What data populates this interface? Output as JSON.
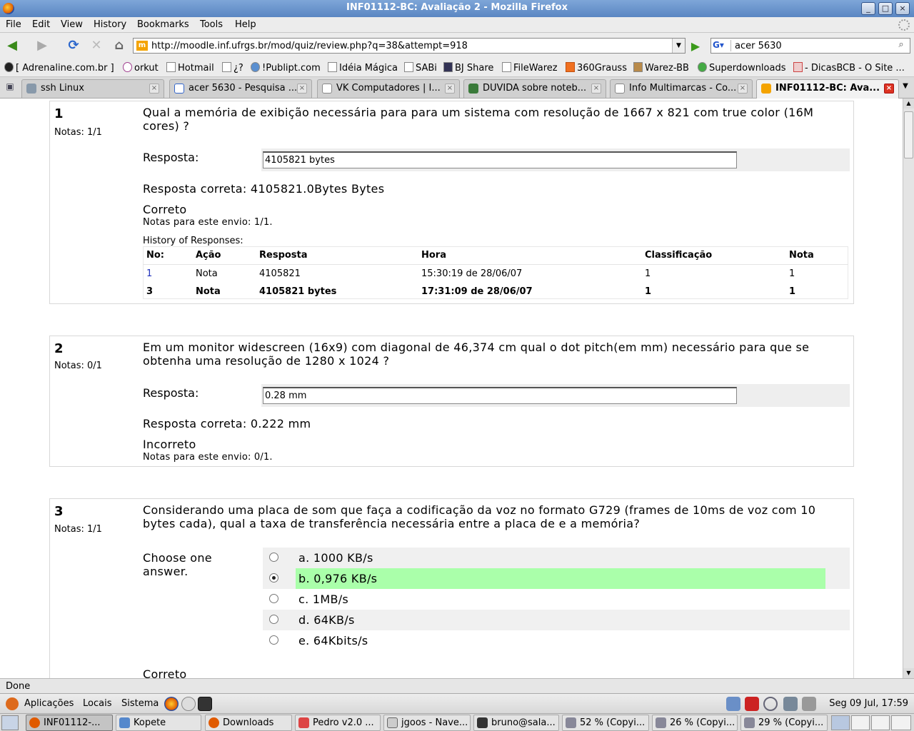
{
  "window": {
    "title": "INF01112-BC: Avaliação 2 - Mozilla Firefox",
    "buttons": [
      "_",
      "□",
      "×"
    ]
  },
  "menu": [
    "File",
    "Edit",
    "View",
    "History",
    "Bookmarks",
    "Tools",
    "Help"
  ],
  "nav": {
    "url": "http://moodle.inf.ufrgs.br/mod/quiz/review.php?q=38&attempt=918",
    "search_engine": "G",
    "search_query": "acer 5630",
    "url_favicon": "m"
  },
  "bookmarks": [
    "[ Adrenaline.com.br ]",
    "orkut",
    "Hotmail",
    "¿?",
    "!Publipt.com",
    "Idéia Mágica",
    "SABi",
    "BJ Share",
    "FileWarez",
    "360Grauss",
    "Warez-BB",
    "Superdownloads",
    "- DicasBCB - O Site ..."
  ],
  "tabs": [
    {
      "label": "ssh Linux",
      "active": false
    },
    {
      "label": "acer 5630 - Pesquisa ...",
      "active": false
    },
    {
      "label": "VK Computadores | I...",
      "active": false
    },
    {
      "label": "DUVIDA sobre noteb...",
      "active": false
    },
    {
      "label": "Info Multimarcas - Co...",
      "active": false
    },
    {
      "label": "INF01112-BC: Ava...",
      "active": true
    }
  ],
  "quiz": {
    "q1": {
      "number": "1",
      "grade": "Notas: 1/1",
      "text": "Qual a memória de exibição necessária para para um sistema com resolução de 1667 x 821 com true color (16M cores) ?",
      "answer_label": "Resposta:",
      "answer_value": "4105821 bytes",
      "correct_answer": "Resposta correta: 4105821.0Bytes Bytes",
      "feedback": "Correto",
      "grade_info": "Notas para este envio: 1/1.",
      "history_title": "History of Responses:",
      "history_headers": [
        "No:",
        "Ação",
        "Resposta",
        "Hora",
        "Classificação",
        "Nota"
      ],
      "history_rows": [
        [
          "1",
          "Nota",
          "4105821",
          "15:30:19 de 28/06/07",
          "1",
          "1"
        ],
        [
          "3",
          "Nota",
          "4105821 bytes",
          "17:31:09 de 28/06/07",
          "1",
          "1"
        ]
      ]
    },
    "q2": {
      "number": "2",
      "grade": "Notas: 0/1",
      "text": "Em um monitor widescreen (16x9) com diagonal de 46,374 cm qual o dot pitch(em mm) necessário para que se obtenha uma resolução de 1280 x 1024 ?",
      "answer_label": "Resposta:",
      "answer_value": "0.28 mm",
      "correct_answer": "Resposta correta: 0.222 mm",
      "feedback": "Incorreto",
      "grade_info": "Notas para este envio: 0/1."
    },
    "q3": {
      "number": "3",
      "grade": "Notas: 1/1",
      "text": "Considerando uma placa de som que faça a codificação da voz no formato G729 (frames de 10ms de voz com 10 bytes cada), qual a taxa de transferência necessária entre a placa de e a memória?",
      "prompt": "Choose one answer.",
      "options": [
        "a. 1000 KB/s",
        "b. 0,976 KB/s",
        "c. 1MB/s",
        "d. 64KB/s",
        "e. 64Kbits/s"
      ],
      "selected_index": 1,
      "feedback": "Correto"
    }
  },
  "status": "Done",
  "panel": {
    "menus": [
      "Aplicações",
      "Locais",
      "Sistema"
    ],
    "clock": "Seg 09 Jul, 17:59"
  },
  "taskbar": [
    {
      "label": "INF01112-...",
      "active": true
    },
    {
      "label": "Kopete",
      "active": false
    },
    {
      "label": "Downloads",
      "active": false
    },
    {
      "label": "Pedro v2.0 ...",
      "active": false
    },
    {
      "label": "jgoos - Nave...",
      "active": false
    },
    {
      "label": "bruno@sala...",
      "active": false
    },
    {
      "label": "52 % (Copyi...",
      "active": false
    },
    {
      "label": "26 % (Copyi...",
      "active": false
    },
    {
      "label": "29 % (Copyi...",
      "active": false
    }
  ],
  "colors": {
    "correct_highlight": "#aaffaa",
    "titlebar": "#6b95cc",
    "link": "#2233bb"
  }
}
